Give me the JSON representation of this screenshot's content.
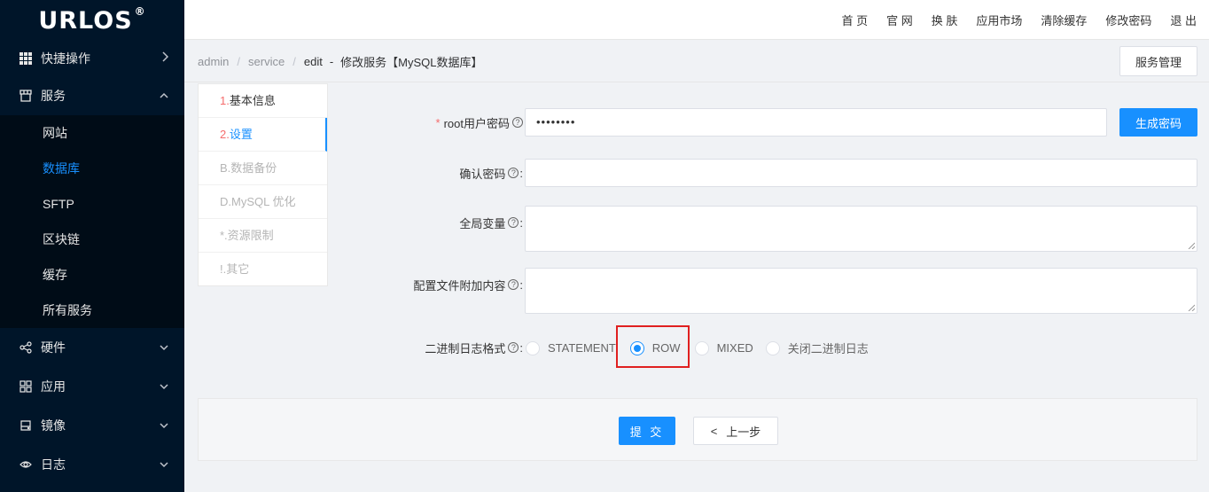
{
  "sidebar": {
    "logo": "URLOS",
    "logo_mark": "®",
    "menu": [
      {
        "label": "快捷操作",
        "icon": "grid-icon"
      },
      {
        "label": "服务",
        "icon": "store-icon"
      },
      {
        "label": "硬件",
        "icon": "share-icon"
      },
      {
        "label": "应用",
        "icon": "apps-icon"
      },
      {
        "label": "镜像",
        "icon": "drive-icon"
      },
      {
        "label": "日志",
        "icon": "eye-icon"
      }
    ],
    "service_sub": [
      "网站",
      "数据库",
      "SFTP",
      "区块链",
      "缓存",
      "所有服务"
    ]
  },
  "topnav": [
    "首 页",
    "官 网",
    "换 肤",
    "应用市场",
    "清除缓存",
    "修改密码",
    "退 出"
  ],
  "breadcrumb": {
    "items": [
      "admin",
      "service",
      "edit"
    ],
    "separator": "/",
    "dash": "-",
    "current": "修改服务【MySQL数据库】"
  },
  "service_manage_button": "服务管理",
  "steps": [
    {
      "num": "1.",
      "label": "基本信息"
    },
    {
      "num": "2.",
      "label": "设置"
    },
    {
      "num": "",
      "label": "B.数据备份"
    },
    {
      "num": "",
      "label": "D.MySQL 优化"
    },
    {
      "num": "",
      "label": "*.资源限制"
    },
    {
      "num": "",
      "label": "!.其它"
    }
  ],
  "form": {
    "required_mark": "*",
    "root_password_label": "root用户密码",
    "root_password_value": "••••••••",
    "generate_button": "生成密码",
    "confirm_password_label": "确认密码",
    "global_vars_label": "全局变量",
    "config_append_label": "配置文件附加内容",
    "binlog_label": "二进制日志格式",
    "help_glyph": "?",
    "colon": ":",
    "binlog_options": [
      "STATEMENT",
      "ROW",
      "MIXED",
      "关闭二进制日志"
    ],
    "binlog_selected": "ROW"
  },
  "actions": {
    "submit": "提 交",
    "prev_chevron": "<",
    "prev": "上一步"
  },
  "colors": {
    "primary": "#1890ff",
    "sidebar": "#001529",
    "highlight": "#e02020",
    "required": "#f56c6c"
  }
}
